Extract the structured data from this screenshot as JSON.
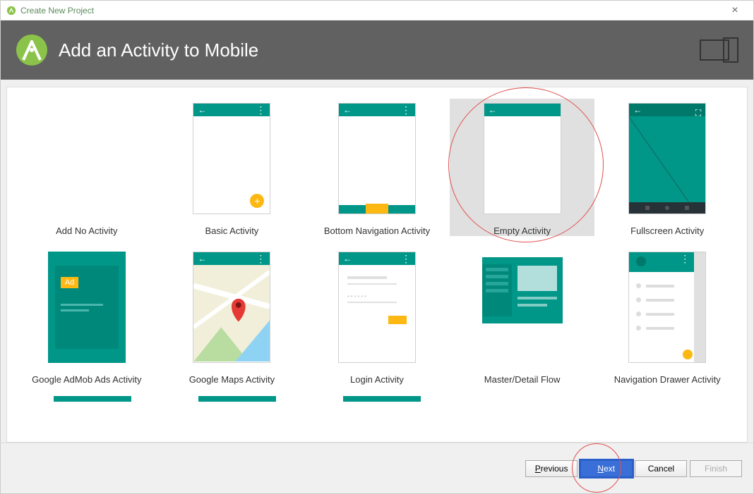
{
  "window": {
    "title": "Create New Project"
  },
  "header": {
    "title": "Add an Activity to Mobile"
  },
  "activities": [
    {
      "label": "Add No Activity",
      "kind": "none"
    },
    {
      "label": "Basic Activity",
      "kind": "basic"
    },
    {
      "label": "Bottom Navigation Activity",
      "kind": "bottomnav"
    },
    {
      "label": "Empty Activity",
      "kind": "empty",
      "selected": true
    },
    {
      "label": "Fullscreen Activity",
      "kind": "fullscreen"
    },
    {
      "label": "Google AdMob Ads Activity",
      "kind": "admob"
    },
    {
      "label": "Google Maps Activity",
      "kind": "maps"
    },
    {
      "label": "Login Activity",
      "kind": "login"
    },
    {
      "label": "Master/Detail Flow",
      "kind": "masterdetail"
    },
    {
      "label": "Navigation Drawer Activity",
      "kind": "navdrawer"
    }
  ],
  "footer": {
    "previous": "Previous",
    "next": "Next",
    "cancel": "Cancel",
    "finish": "Finish"
  },
  "ad_label": "Ad"
}
